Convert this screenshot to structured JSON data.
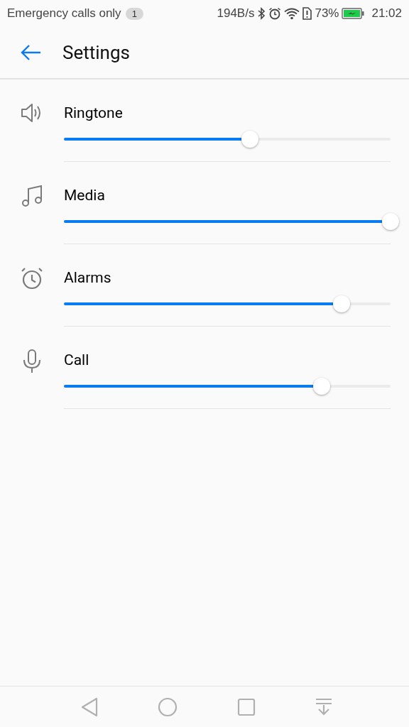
{
  "status_bar": {
    "carrier": "Emergency calls only",
    "notification_count": "1",
    "network_speed": "194B/s",
    "battery_percent": "73%",
    "time": "21:02"
  },
  "app_bar": {
    "title": "Settings"
  },
  "volumes": [
    {
      "kind": "speaker",
      "label": "Ringtone",
      "level": 0.57
    },
    {
      "kind": "music",
      "label": "Media",
      "level": 1.0
    },
    {
      "kind": "alarm",
      "label": "Alarms",
      "level": 0.85
    },
    {
      "kind": "mic",
      "label": "Call",
      "level": 0.79
    }
  ]
}
